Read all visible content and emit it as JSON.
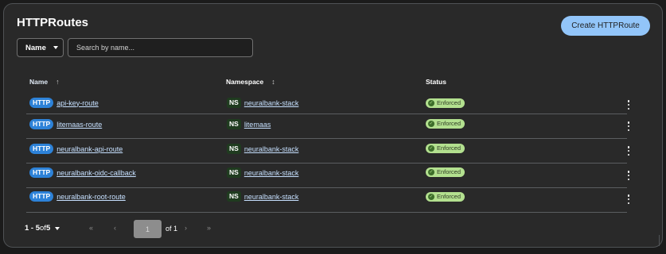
{
  "header": {
    "title": "HTTPRoutes",
    "create_label": "Create HTTPRoute"
  },
  "toolbar": {
    "filter_label": "Name",
    "search_placeholder": "Search by name..."
  },
  "table": {
    "columns": [
      {
        "label": "Name",
        "sort_icon": "↑"
      },
      {
        "label": "Namespace",
        "sort_icon": "↕"
      },
      {
        "label": "Status"
      }
    ],
    "rows": [
      {
        "kind": "HTTP",
        "name": "api-key-route",
        "ns_badge": "NS",
        "namespace": "neuralbank-stack",
        "status": "Enforced"
      },
      {
        "kind": "HTTP",
        "name": "litemaas-route",
        "ns_badge": "NS",
        "namespace": "litemaas",
        "status": "Enforced"
      },
      {
        "kind": "HTTP",
        "name": "neuralbank-api-route",
        "ns_badge": "NS",
        "namespace": "neuralbank-stack",
        "status": "Enforced"
      },
      {
        "kind": "HTTP",
        "name": "neuralbank-oidc-callback",
        "ns_badge": "NS",
        "namespace": "neuralbank-stack",
        "status": "Enforced"
      },
      {
        "kind": "HTTP",
        "name": "neuralbank-root-route",
        "ns_badge": "NS",
        "namespace": "neuralbank-stack",
        "status": "Enforced"
      }
    ]
  },
  "pagination": {
    "range": "1 - 5",
    "of_word": "of",
    "total": "5",
    "first_icon": "«",
    "prev_icon": "‹",
    "current_page": "1",
    "of_pages": "of 1",
    "next_icon": "›",
    "last_icon": "»"
  },
  "colors": {
    "accent": "#92c5f9",
    "link": "#c6e0ff",
    "http_badge": "#2d82d8",
    "status_bg": "#b3e08f"
  }
}
